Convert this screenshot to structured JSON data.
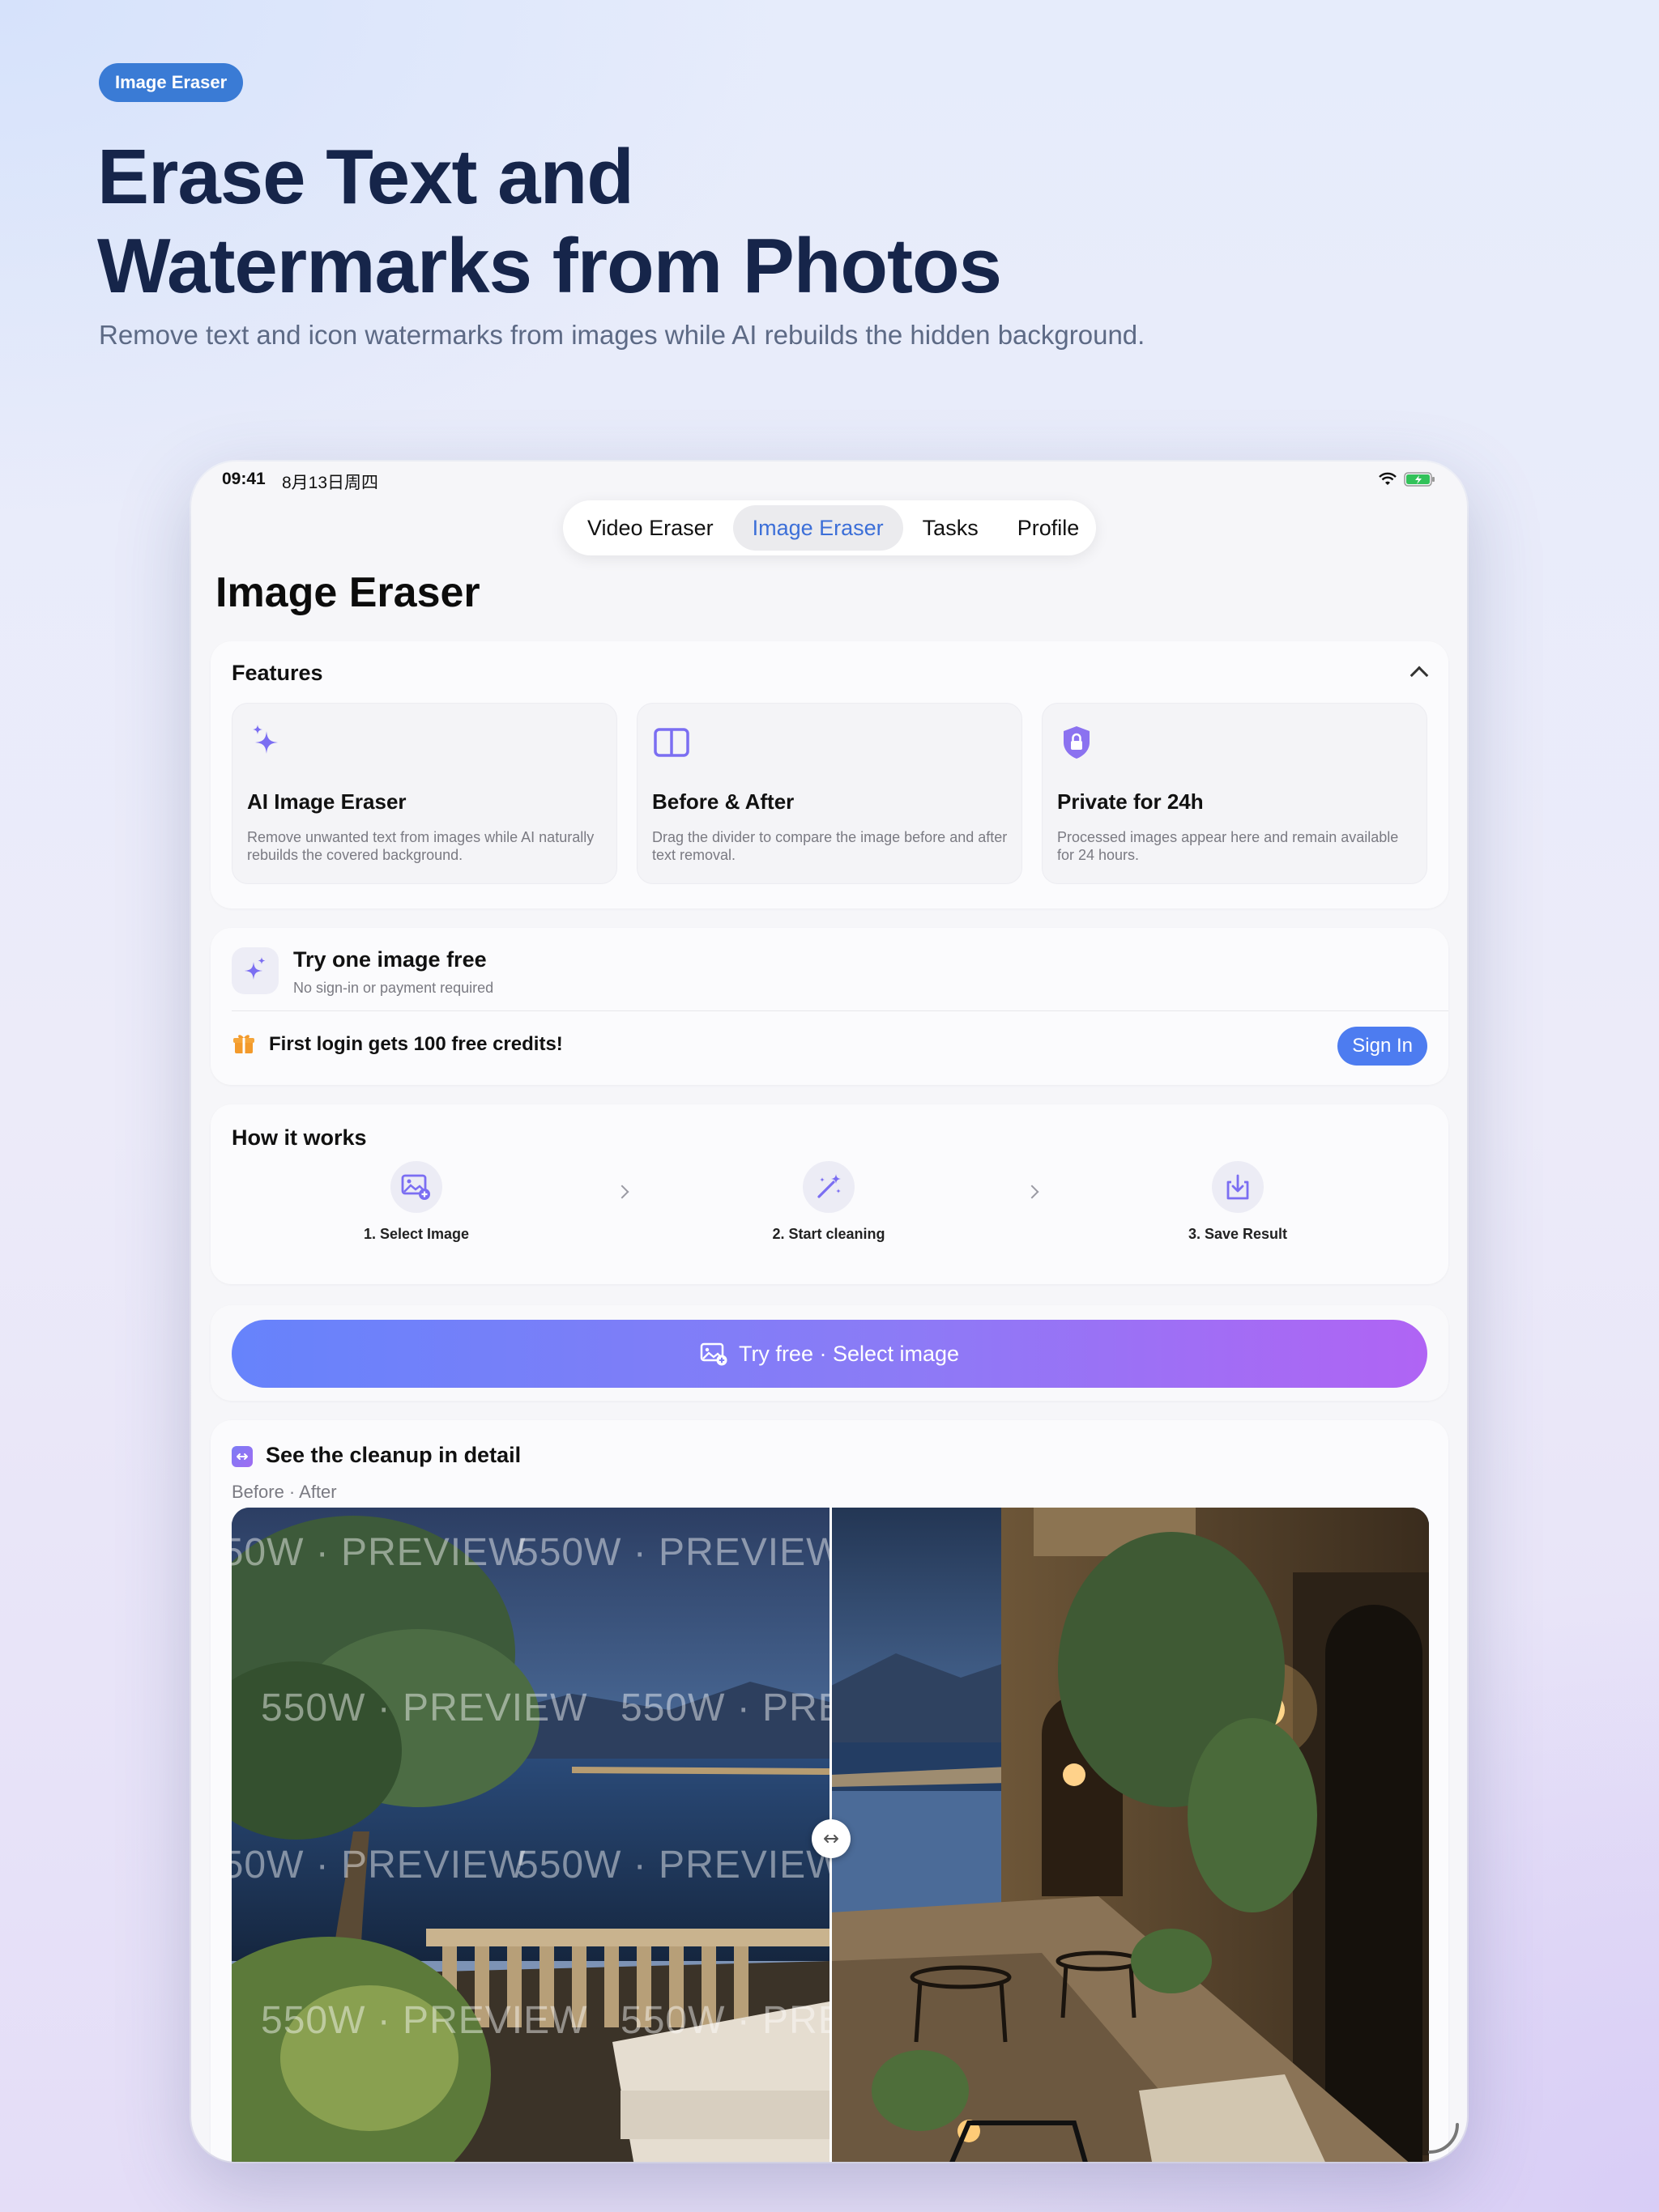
{
  "hero": {
    "pill": "Image Eraser",
    "title_line1": "Erase Text and",
    "title_line2": "Watermarks from Photos",
    "subtitle": "Remove text and icon watermarks from images while AI rebuilds the hidden background."
  },
  "status_bar": {
    "time": "09:41",
    "date": "8月13日周四",
    "icons": [
      "wifi-icon",
      "battery-charging-icon"
    ]
  },
  "tabs": [
    {
      "label": "Video Eraser",
      "active": false
    },
    {
      "label": "Image Eraser",
      "active": true
    },
    {
      "label": "Tasks",
      "active": false
    },
    {
      "label": "Profile",
      "active": false
    }
  ],
  "page_title": "Image Eraser",
  "features": {
    "heading": "Features",
    "items": [
      {
        "icon": "sparkles-icon",
        "title": "AI Image Eraser",
        "desc": "Remove unwanted text from images while AI naturally rebuilds the covered background."
      },
      {
        "icon": "split-view-icon",
        "title": "Before & After",
        "desc": "Drag the divider to compare the image before and after text removal."
      },
      {
        "icon": "lock-shield-icon",
        "title": "Private for 24h",
        "desc": "Processed images appear here and remain available for 24 hours."
      }
    ]
  },
  "try_free": {
    "title": "Try one image free",
    "subtitle": "No sign-in or payment required",
    "promo": "First login gets 100 free credits!",
    "signin_label": "Sign In"
  },
  "how_it_works": {
    "heading": "How it works",
    "steps": [
      {
        "icon": "image-add-icon",
        "label": "1. Select Image"
      },
      {
        "icon": "magic-wand-icon",
        "label": "2. Start cleaning"
      },
      {
        "icon": "download-tray-icon",
        "label": "3. Save Result"
      }
    ]
  },
  "cta": {
    "label": "Try free · Select image"
  },
  "detail": {
    "title": "See the cleanup in detail",
    "subtitle": "Before · After",
    "watermark_text": "550W · PREVIEW"
  },
  "colors": {
    "accent": "#3a7bd5",
    "tab_active": "#3c6fd8",
    "signin": "#4d7cf0",
    "cta_start": "#6683fb",
    "cta_end": "#b064f4",
    "icon_purple": "#7b6ef2"
  }
}
